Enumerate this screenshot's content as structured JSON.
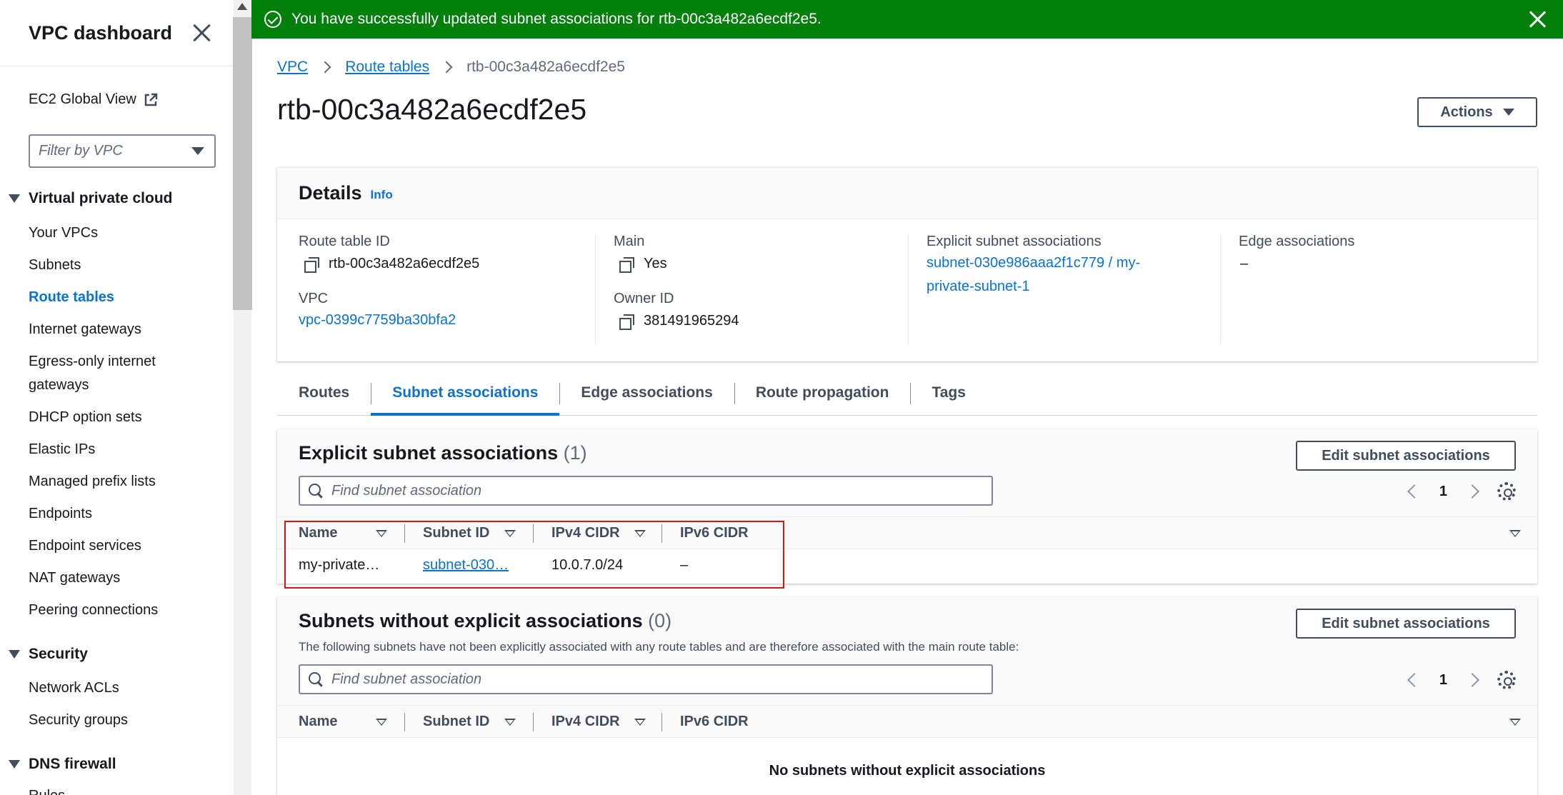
{
  "sidebar": {
    "title": "VPC dashboard",
    "global_view": "EC2 Global View",
    "filter_placeholder": "Filter by VPC",
    "sections": [
      {
        "label": "Virtual private cloud"
      },
      {
        "label": "Security"
      },
      {
        "label": "DNS firewall"
      }
    ],
    "vpc_items": [
      "Your VPCs",
      "Subnets",
      "Route tables",
      "Internet gateways",
      "Egress-only internet gateways",
      "DHCP option sets",
      "Elastic IPs",
      "Managed prefix lists",
      "Endpoints",
      "Endpoint services",
      "NAT gateways",
      "Peering connections"
    ],
    "security_items": [
      "Network ACLs",
      "Security groups"
    ],
    "dns_partial": "Rules",
    "active_item": "Route tables"
  },
  "flash": {
    "message": "You have successfully updated subnet associations for rtb-00c3a482a6ecdf2e5.",
    "color": "#037f0c"
  },
  "breadcrumb": {
    "items": [
      "VPC",
      "Route tables"
    ],
    "current": "rtb-00c3a482a6ecdf2e5"
  },
  "page": {
    "title": "rtb-00c3a482a6ecdf2e5",
    "actions_label": "Actions"
  },
  "details": {
    "title": "Details",
    "info": "Info",
    "route_table_id_label": "Route table ID",
    "route_table_id": "rtb-00c3a482a6ecdf2e5",
    "vpc_label": "VPC",
    "vpc": "vpc-0399c7759ba30bfa2",
    "main_label": "Main",
    "main": "Yes",
    "owner_label": "Owner ID",
    "owner": "381491965294",
    "explicit_label": "Explicit subnet associations",
    "explicit_line1": "subnet-030e986aaa2f1c779 / my-",
    "explicit_line2": "private-subnet-1",
    "edge_label": "Edge associations",
    "edge": "–"
  },
  "tabs": [
    "Routes",
    "Subnet associations",
    "Edge associations",
    "Route propagation",
    "Tags"
  ],
  "explicit_table": {
    "title": "Explicit subnet associations",
    "count": "(1)",
    "edit_label": "Edit subnet associations",
    "search_placeholder": "Find subnet association",
    "page": "1",
    "columns": [
      "Name",
      "Subnet ID",
      "IPv4 CIDR",
      "IPv6 CIDR"
    ],
    "rows": [
      {
        "name": "my-private…",
        "subnet_id": "subnet-030…",
        "ipv4": "10.0.7.0/24",
        "ipv6": "–"
      }
    ]
  },
  "implicit_table": {
    "title": "Subnets without explicit associations",
    "count": "(0)",
    "description": "The following subnets have not been explicitly associated with any route tables and are therefore associated with the main route table:",
    "edit_label": "Edit subnet associations",
    "search_placeholder": "Find subnet association",
    "page": "1",
    "columns": [
      "Name",
      "Subnet ID",
      "IPv4 CIDR",
      "IPv6 CIDR"
    ],
    "empty_message": "No subnets without explicit associations"
  },
  "colors": {
    "link": "#0972d3",
    "highlight": "#d91515"
  }
}
